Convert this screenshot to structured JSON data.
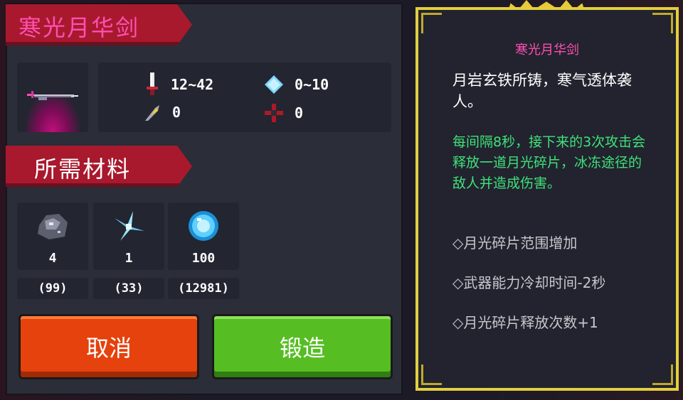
{
  "weapon": {
    "name": "寒光月华剑",
    "stats": {
      "damage": "12~42",
      "energy": "0~10",
      "crit": "0",
      "accuracy": "0"
    }
  },
  "materials": {
    "header": "所需材料",
    "items": [
      {
        "icon": "iron-ore-icon",
        "count": "4",
        "owned": "(99)"
      },
      {
        "icon": "crystal-shard-icon",
        "count": "1",
        "owned": "(33)"
      },
      {
        "icon": "blue-gem-icon",
        "count": "100",
        "owned": "(12981)"
      }
    ]
  },
  "buttons": {
    "cancel": "取消",
    "forge": "锻造"
  },
  "detail": {
    "title": "寒光月华剑",
    "description": "月岩玄铁所铸，寒气透体袭人。",
    "effect": "每间隔8秒，接下来的3次攻击会释放一道月光碎片，冰冻途径的敌人并造成伤害。",
    "bonuses": [
      "◇月光碎片范围增加",
      "◇武器能力冷却时间-2秒",
      "◇月光碎片释放次数+1"
    ]
  },
  "colors": {
    "ribbon": "#a8192e",
    "title_pink": "#ff4fb1",
    "cancel": "#e5420d",
    "forge": "#56be22",
    "effect_green": "#3fe27a",
    "frame_gold": "#e2cf3e"
  }
}
